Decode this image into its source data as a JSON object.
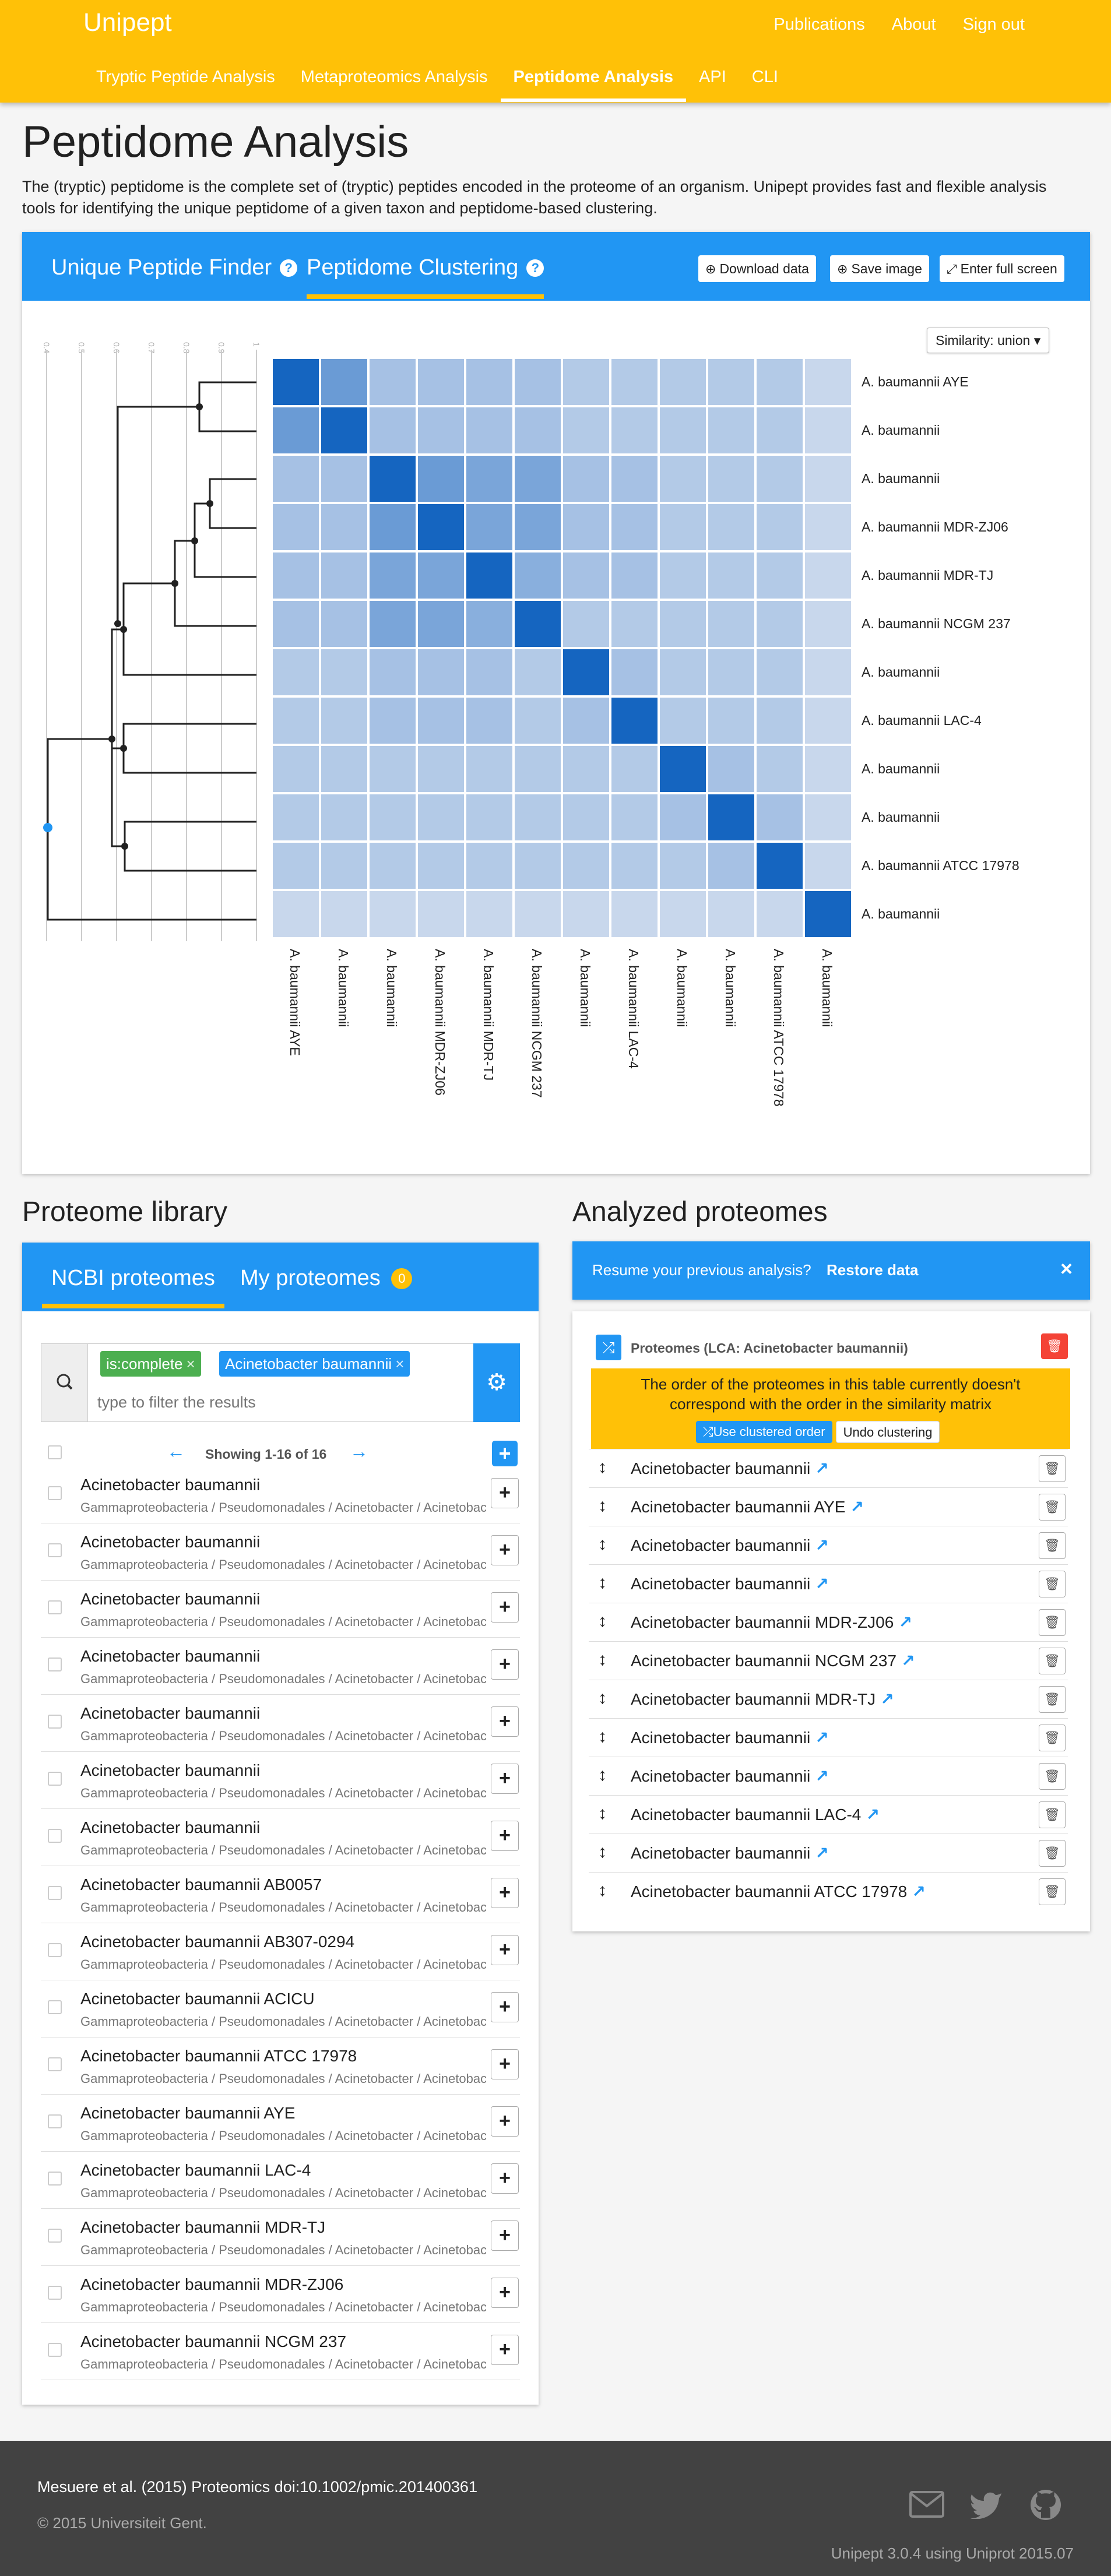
{
  "header": {
    "brand": "Unipept",
    "links": [
      "Publications",
      "About",
      "Sign out"
    ],
    "tabs": [
      "Tryptic Peptide Analysis",
      "Metaproteomics Analysis",
      "Peptidome Analysis",
      "API",
      "CLI"
    ],
    "active_tab": "Peptidome Analysis"
  },
  "page": {
    "title": "Peptidome Analysis",
    "intro": "The (tryptic) peptidome is the complete set of (tryptic) peptides encoded in the proteome of an organism. Unipept provides fast and flexible analysis tools for identifying the unique peptidome of a given taxon and peptidome-based clustering."
  },
  "clustering": {
    "tabs": [
      "Unique Peptide Finder",
      "Peptidome Clustering"
    ],
    "active_tab": "Peptidome Clustering",
    "buttons": {
      "download": "Download data",
      "save": "Save image",
      "fullscreen": "Enter full screen"
    },
    "similarity": "Similarity: union",
    "axis_ticks": [
      "0.4",
      "0.5",
      "0.6",
      "0.7",
      "0.8",
      "0.9",
      "1"
    ],
    "labels": [
      "A. baumannii AYE",
      "A. baumannii",
      "A. baumannii",
      "A. baumannii MDR-ZJ06",
      "A. baumannii MDR-TJ",
      "A. baumannii NCGM 237",
      "A. baumannii",
      "A. baumannii LAC-4",
      "A. baumannii",
      "A. baumannii",
      "A. baumannii ATCC 17978",
      "A. baumannii"
    ],
    "colors": {
      "high": "#1565c0",
      "medium": "#5c8fd6",
      "low": "#a4c2e8",
      "faint": "#c5d6ec"
    }
  },
  "chart_data": {
    "type": "heatmap",
    "title": "",
    "rows": [
      "A. baumannii AYE",
      "A. baumannii",
      "A. baumannii",
      "A. baumannii MDR-ZJ06",
      "A. baumannii MDR-TJ",
      "A. baumannii NCGM 237",
      "A. baumannii",
      "A. baumannii LAC-4",
      "A. baumannii",
      "A. baumannii",
      "A. baumannii ATCC 17978",
      "A. baumannii"
    ],
    "columns": [
      "A. baumannii AYE",
      "A. baumannii",
      "A. baumannii",
      "A. baumannii MDR-ZJ06",
      "A. baumannii MDR-TJ",
      "A. baumannii NCGM 237",
      "A. baumannii",
      "A. baumannii LAC-4",
      "A. baumannii",
      "A. baumannii",
      "A. baumannii ATCC 17978",
      "A. baumannii"
    ],
    "values": [
      [
        1.0,
        0.75,
        0.55,
        0.55,
        0.55,
        0.55,
        0.5,
        0.5,
        0.5,
        0.5,
        0.5,
        0.4
      ],
      [
        0.75,
        1.0,
        0.55,
        0.55,
        0.55,
        0.55,
        0.5,
        0.5,
        0.5,
        0.5,
        0.5,
        0.4
      ],
      [
        0.55,
        0.55,
        1.0,
        0.75,
        0.7,
        0.7,
        0.55,
        0.55,
        0.5,
        0.5,
        0.5,
        0.4
      ],
      [
        0.55,
        0.55,
        0.75,
        1.0,
        0.7,
        0.7,
        0.55,
        0.55,
        0.5,
        0.5,
        0.5,
        0.4
      ],
      [
        0.55,
        0.55,
        0.7,
        0.7,
        1.0,
        0.65,
        0.55,
        0.55,
        0.5,
        0.5,
        0.5,
        0.4
      ],
      [
        0.55,
        0.55,
        0.7,
        0.7,
        0.65,
        1.0,
        0.5,
        0.5,
        0.5,
        0.5,
        0.5,
        0.4
      ],
      [
        0.5,
        0.5,
        0.55,
        0.55,
        0.55,
        0.5,
        1.0,
        0.55,
        0.5,
        0.5,
        0.5,
        0.4
      ],
      [
        0.5,
        0.5,
        0.55,
        0.55,
        0.55,
        0.5,
        0.55,
        1.0,
        0.5,
        0.5,
        0.5,
        0.4
      ],
      [
        0.5,
        0.5,
        0.5,
        0.5,
        0.5,
        0.5,
        0.5,
        0.5,
        1.0,
        0.55,
        0.5,
        0.4
      ],
      [
        0.5,
        0.5,
        0.5,
        0.5,
        0.5,
        0.5,
        0.5,
        0.5,
        0.55,
        1.0,
        0.55,
        0.4
      ],
      [
        0.5,
        0.5,
        0.5,
        0.5,
        0.5,
        0.5,
        0.5,
        0.5,
        0.5,
        0.55,
        1.0,
        0.4
      ],
      [
        0.4,
        0.4,
        0.4,
        0.4,
        0.4,
        0.4,
        0.4,
        0.4,
        0.4,
        0.4,
        0.4,
        1.0
      ]
    ],
    "xlabel": "",
    "ylabel": "",
    "ylim": [
      0.4,
      1
    ]
  },
  "library": {
    "title": "Proteome library",
    "tabs": [
      "NCBI proteomes",
      "My proteomes"
    ],
    "my_count": "0",
    "tags": [
      "is:complete",
      "Acinetobacter baumannii"
    ],
    "placeholder": "type to filter the results",
    "showing": "Showing 1-16 of 16",
    "lineage": "Gammaproteobacteria / Pseudomonadales / Acinetobacter / Acinetobacter",
    "items": [
      "Acinetobacter baumannii",
      "Acinetobacter baumannii",
      "Acinetobacter baumannii",
      "Acinetobacter baumannii",
      "Acinetobacter baumannii",
      "Acinetobacter baumannii",
      "Acinetobacter baumannii",
      "Acinetobacter baumannii AB0057",
      "Acinetobacter baumannii AB307-0294",
      "Acinetobacter baumannii ACICU",
      "Acinetobacter baumannii ATCC 17978",
      "Acinetobacter baumannii AYE",
      "Acinetobacter baumannii LAC-4",
      "Acinetobacter baumannii MDR-TJ",
      "Acinetobacter baumannii MDR-ZJ06",
      "Acinetobacter baumannii NCGM 237"
    ]
  },
  "analyzed": {
    "title": "Analyzed proteomes",
    "resume_text": "Resume your previous analysis?",
    "restore": "Restore data",
    "panel_title": "Proteomes (LCA: Acinetobacter baumannii)",
    "warning": "The order of the proteomes in this table currently doesn't correspond with the order in the similarity matrix",
    "use_clustered": "Use clustered order",
    "undo": "Undo clustering",
    "items": [
      "Acinetobacter baumannii",
      "Acinetobacter baumannii AYE",
      "Acinetobacter baumannii",
      "Acinetobacter baumannii",
      "Acinetobacter baumannii MDR-ZJ06",
      "Acinetobacter baumannii NCGM 237",
      "Acinetobacter baumannii MDR-TJ",
      "Acinetobacter baumannii",
      "Acinetobacter baumannii",
      "Acinetobacter baumannii LAC-4",
      "Acinetobacter baumannii",
      "Acinetobacter baumannii ATCC 17978"
    ]
  },
  "footer": {
    "citation": "Mesuere et al. (2015) Proteomics doi:10.1002/pmic.201400361",
    "copyright": "© 2015 Universiteit Gent.",
    "version": "Unipept 3.0.4 using Uniprot 2015.07"
  }
}
